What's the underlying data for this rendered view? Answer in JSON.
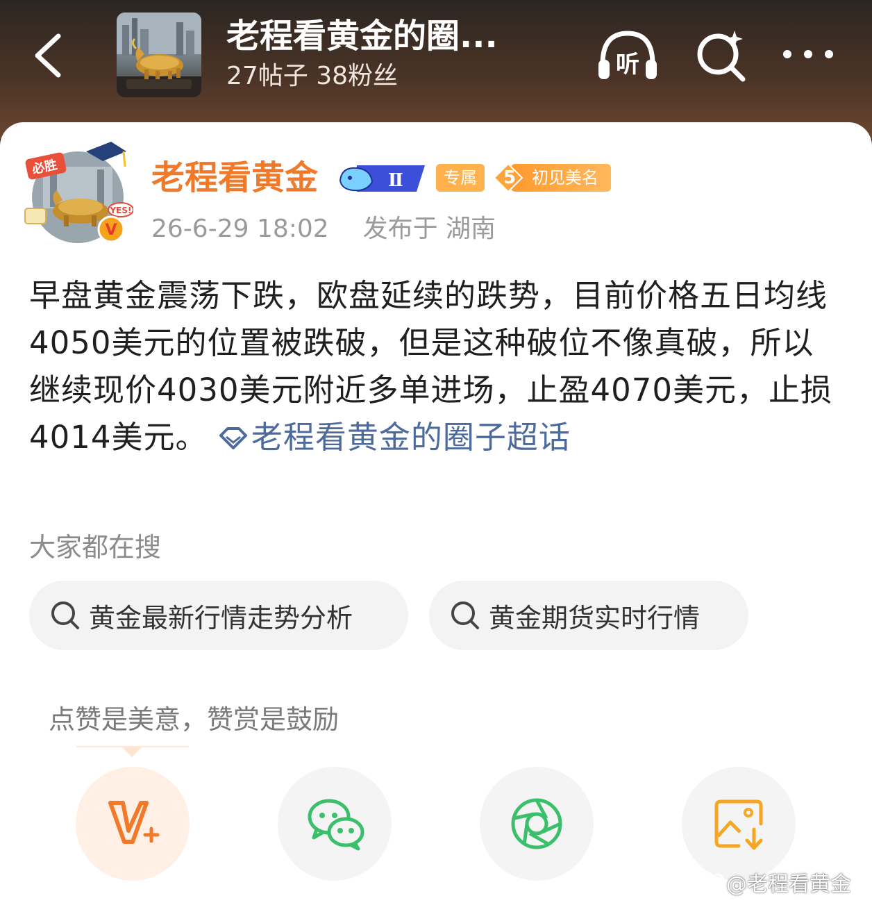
{
  "header": {
    "title": "老程看黄金的圈...",
    "subtitle": "27帖子 38粉丝",
    "listen_label": "听"
  },
  "post": {
    "author": "老程看黄金",
    "badges": {
      "level": "Ⅱ",
      "exclusive": "专属",
      "fame_level": "5",
      "fame_label": "初见美名"
    },
    "avatar_sticker_top": "必胜",
    "avatar_sticker_side": "YES!",
    "avatar_verified": "V",
    "timestamp": "26-6-29 18:02",
    "location": "发布于 湖南",
    "body": "早盘黄金震荡下跌，欧盘延续的跌势，目前价格五日均线4050美元的位置被跌破，但是这种破位不像真破，所以继续现价4030美元附近多单进场，止盈4070美元，止损4014美元。",
    "topic_link": "老程看黄金的圈子超话"
  },
  "search_section": {
    "heading": "大家都在搜",
    "chips": [
      "黄金最新行情走势分析",
      "黄金期货实时行情"
    ]
  },
  "reward": {
    "tip": "点赞是美意，赞赏是鼓励"
  },
  "actions": [
    {
      "icon": "v-plus-icon",
      "color": "#f07a2a"
    },
    {
      "icon": "wechat-icon",
      "color": "#3bbf6a"
    },
    {
      "icon": "moments-icon",
      "color": "#3bbf6a"
    },
    {
      "icon": "save-image-icon",
      "color": "#f5a623"
    }
  ],
  "watermark": "@老程看黄金",
  "colors": {
    "accent": "#f07a2a",
    "link": "#4c6a9b",
    "header_bg": "#4a3326"
  }
}
